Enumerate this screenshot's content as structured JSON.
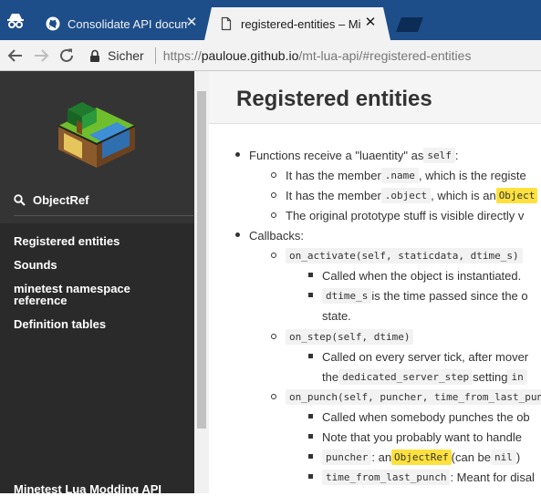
{
  "browser": {
    "tabs": [
      {
        "title": "Consolidate API docume",
        "active": false
      },
      {
        "title": "registered-entities – Min",
        "active": true
      }
    ],
    "secure_label": "Sicher",
    "url_scheme": "https://",
    "url_host": "pauloue.github.io",
    "url_path": "/mt-lua-api/#registered-entities"
  },
  "sidebar": {
    "search_label": "ObjectRef",
    "nav": [
      "Registered entities",
      "Sounds",
      "minetest namespace reference",
      "Definition tables"
    ],
    "footer": "Minetest Lua Modding API"
  },
  "page": {
    "title": "Registered entities",
    "lines": {
      "l1": [
        "Functions receive a \"luaentity\" as ",
        "self",
        ":"
      ],
      "l2": [
        "It has the member ",
        ".name",
        ", which is the registe"
      ],
      "l3": [
        "It has the member ",
        ".object",
        ", which is an ",
        "Object"
      ],
      "l4": "The original prototype stuff is visible directly v",
      "l5": "Callbacks:",
      "l6": "on_activate(self, staticdata, dtime_s)",
      "l7": "Called when the object is instantiated.",
      "l8": [
        "dtime_s",
        " is the time passed since the o"
      ],
      "l9": "state.",
      "l10": "on_step(self, dtime)",
      "l11": "Called on every server tick, after mover",
      "l12": [
        "the ",
        "dedicated_server_step",
        " setting ",
        "in"
      ],
      "l13": "on_punch(self, puncher, time_from_last_pun",
      "l14": "Called when somebody punches the ob",
      "l15": "Note that you probably want to handle",
      "l16": [
        "puncher",
        ": an ",
        "ObjectRef",
        " (can be ",
        "nil",
        ")"
      ],
      "l17": [
        "time_from_last_punch",
        ": Meant for disal"
      ]
    }
  },
  "colors": {
    "tabbar": "#1d4e8a",
    "sidebar": "#2a2a2a",
    "highlight": "#ffe13d"
  }
}
